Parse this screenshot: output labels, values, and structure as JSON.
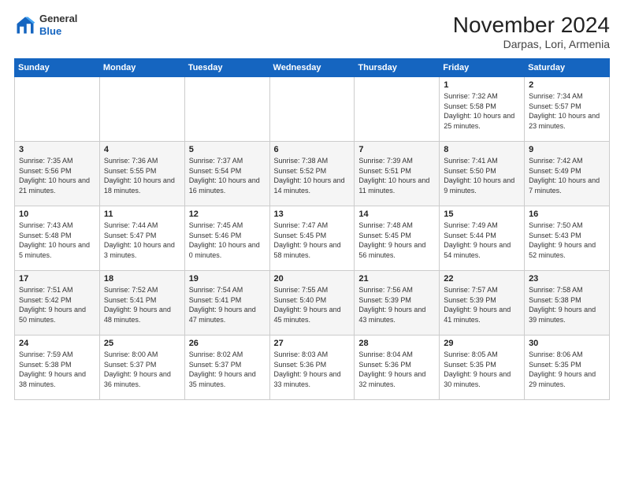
{
  "header": {
    "logo_general": "General",
    "logo_blue": "Blue",
    "month_title": "November 2024",
    "location": "Darpas, Lori, Armenia"
  },
  "weekdays": [
    "Sunday",
    "Monday",
    "Tuesday",
    "Wednesday",
    "Thursday",
    "Friday",
    "Saturday"
  ],
  "weeks": [
    [
      {
        "day": "",
        "info": ""
      },
      {
        "day": "",
        "info": ""
      },
      {
        "day": "",
        "info": ""
      },
      {
        "day": "",
        "info": ""
      },
      {
        "day": "",
        "info": ""
      },
      {
        "day": "1",
        "info": "Sunrise: 7:32 AM\nSunset: 5:58 PM\nDaylight: 10 hours and 25 minutes."
      },
      {
        "day": "2",
        "info": "Sunrise: 7:34 AM\nSunset: 5:57 PM\nDaylight: 10 hours and 23 minutes."
      }
    ],
    [
      {
        "day": "3",
        "info": "Sunrise: 7:35 AM\nSunset: 5:56 PM\nDaylight: 10 hours and 21 minutes."
      },
      {
        "day": "4",
        "info": "Sunrise: 7:36 AM\nSunset: 5:55 PM\nDaylight: 10 hours and 18 minutes."
      },
      {
        "day": "5",
        "info": "Sunrise: 7:37 AM\nSunset: 5:54 PM\nDaylight: 10 hours and 16 minutes."
      },
      {
        "day": "6",
        "info": "Sunrise: 7:38 AM\nSunset: 5:52 PM\nDaylight: 10 hours and 14 minutes."
      },
      {
        "day": "7",
        "info": "Sunrise: 7:39 AM\nSunset: 5:51 PM\nDaylight: 10 hours and 11 minutes."
      },
      {
        "day": "8",
        "info": "Sunrise: 7:41 AM\nSunset: 5:50 PM\nDaylight: 10 hours and 9 minutes."
      },
      {
        "day": "9",
        "info": "Sunrise: 7:42 AM\nSunset: 5:49 PM\nDaylight: 10 hours and 7 minutes."
      }
    ],
    [
      {
        "day": "10",
        "info": "Sunrise: 7:43 AM\nSunset: 5:48 PM\nDaylight: 10 hours and 5 minutes."
      },
      {
        "day": "11",
        "info": "Sunrise: 7:44 AM\nSunset: 5:47 PM\nDaylight: 10 hours and 3 minutes."
      },
      {
        "day": "12",
        "info": "Sunrise: 7:45 AM\nSunset: 5:46 PM\nDaylight: 10 hours and 0 minutes."
      },
      {
        "day": "13",
        "info": "Sunrise: 7:47 AM\nSunset: 5:45 PM\nDaylight: 9 hours and 58 minutes."
      },
      {
        "day": "14",
        "info": "Sunrise: 7:48 AM\nSunset: 5:45 PM\nDaylight: 9 hours and 56 minutes."
      },
      {
        "day": "15",
        "info": "Sunrise: 7:49 AM\nSunset: 5:44 PM\nDaylight: 9 hours and 54 minutes."
      },
      {
        "day": "16",
        "info": "Sunrise: 7:50 AM\nSunset: 5:43 PM\nDaylight: 9 hours and 52 minutes."
      }
    ],
    [
      {
        "day": "17",
        "info": "Sunrise: 7:51 AM\nSunset: 5:42 PM\nDaylight: 9 hours and 50 minutes."
      },
      {
        "day": "18",
        "info": "Sunrise: 7:52 AM\nSunset: 5:41 PM\nDaylight: 9 hours and 48 minutes."
      },
      {
        "day": "19",
        "info": "Sunrise: 7:54 AM\nSunset: 5:41 PM\nDaylight: 9 hours and 47 minutes."
      },
      {
        "day": "20",
        "info": "Sunrise: 7:55 AM\nSunset: 5:40 PM\nDaylight: 9 hours and 45 minutes."
      },
      {
        "day": "21",
        "info": "Sunrise: 7:56 AM\nSunset: 5:39 PM\nDaylight: 9 hours and 43 minutes."
      },
      {
        "day": "22",
        "info": "Sunrise: 7:57 AM\nSunset: 5:39 PM\nDaylight: 9 hours and 41 minutes."
      },
      {
        "day": "23",
        "info": "Sunrise: 7:58 AM\nSunset: 5:38 PM\nDaylight: 9 hours and 39 minutes."
      }
    ],
    [
      {
        "day": "24",
        "info": "Sunrise: 7:59 AM\nSunset: 5:38 PM\nDaylight: 9 hours and 38 minutes."
      },
      {
        "day": "25",
        "info": "Sunrise: 8:00 AM\nSunset: 5:37 PM\nDaylight: 9 hours and 36 minutes."
      },
      {
        "day": "26",
        "info": "Sunrise: 8:02 AM\nSunset: 5:37 PM\nDaylight: 9 hours and 35 minutes."
      },
      {
        "day": "27",
        "info": "Sunrise: 8:03 AM\nSunset: 5:36 PM\nDaylight: 9 hours and 33 minutes."
      },
      {
        "day": "28",
        "info": "Sunrise: 8:04 AM\nSunset: 5:36 PM\nDaylight: 9 hours and 32 minutes."
      },
      {
        "day": "29",
        "info": "Sunrise: 8:05 AM\nSunset: 5:35 PM\nDaylight: 9 hours and 30 minutes."
      },
      {
        "day": "30",
        "info": "Sunrise: 8:06 AM\nSunset: 5:35 PM\nDaylight: 9 hours and 29 minutes."
      }
    ]
  ]
}
